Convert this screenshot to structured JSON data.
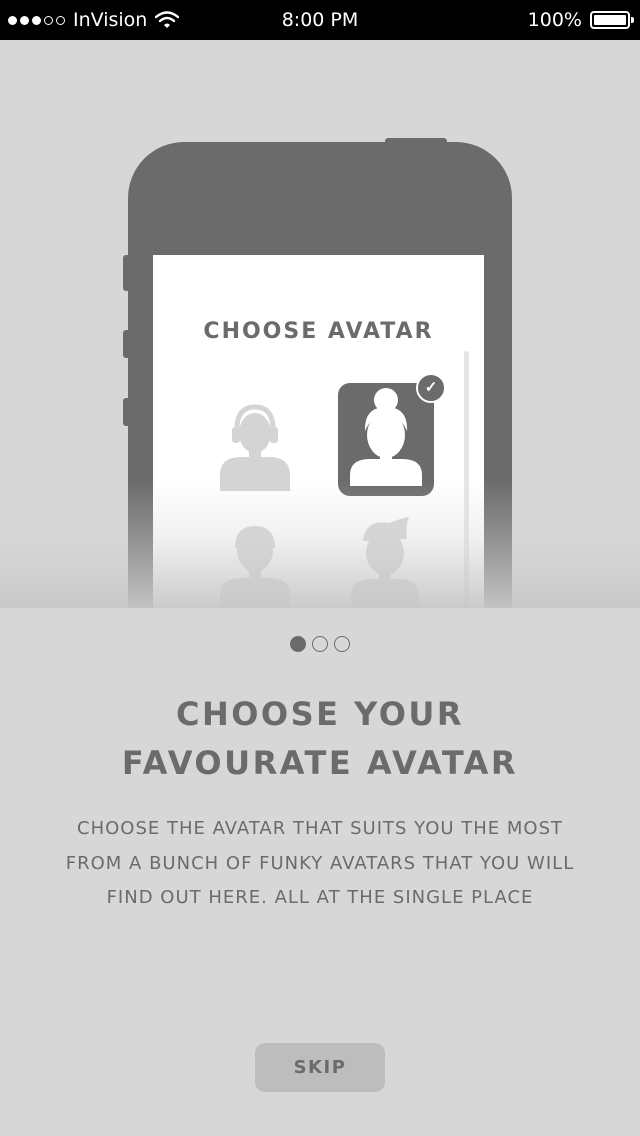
{
  "status_bar": {
    "carrier": "InVision",
    "time": "8:00 PM",
    "battery": "100%",
    "signal_bars_filled": 3,
    "signal_bars_total": 5
  },
  "illustration": {
    "screen_title": "CHOOSE AVATAR",
    "avatars": [
      {
        "name": "avatar-headphones-icon",
        "selected": false
      },
      {
        "name": "avatar-bun-hair-icon",
        "selected": true
      },
      {
        "name": "avatar-cap-icon",
        "selected": false
      },
      {
        "name": "avatar-quiff-hair-icon",
        "selected": false
      }
    ],
    "selected_badge_icon": "checkmark-icon"
  },
  "pager": {
    "count": 3,
    "active": 0
  },
  "heading": {
    "line1": "CHOOSE YOUR",
    "line2": "FAVOURATE AVATAR"
  },
  "description": {
    "line1": "CHOOSE THE AVATAR THAT SUITS YOU THE MOST",
    "line2": "FROM A BUNCH OF FUNKY AVATARS THAT YOU WILL",
    "line3": "FIND OUT HERE. ALL AT THE SINGLE PLACE"
  },
  "skip_button": {
    "label": "SKIP"
  },
  "colors": {
    "background": "#d7d7d7",
    "primary_gray": "#6b6b6b",
    "light_avatar": "#d4d4d4",
    "skip_button": "#bdbdbd",
    "status_bar": "#000000"
  }
}
